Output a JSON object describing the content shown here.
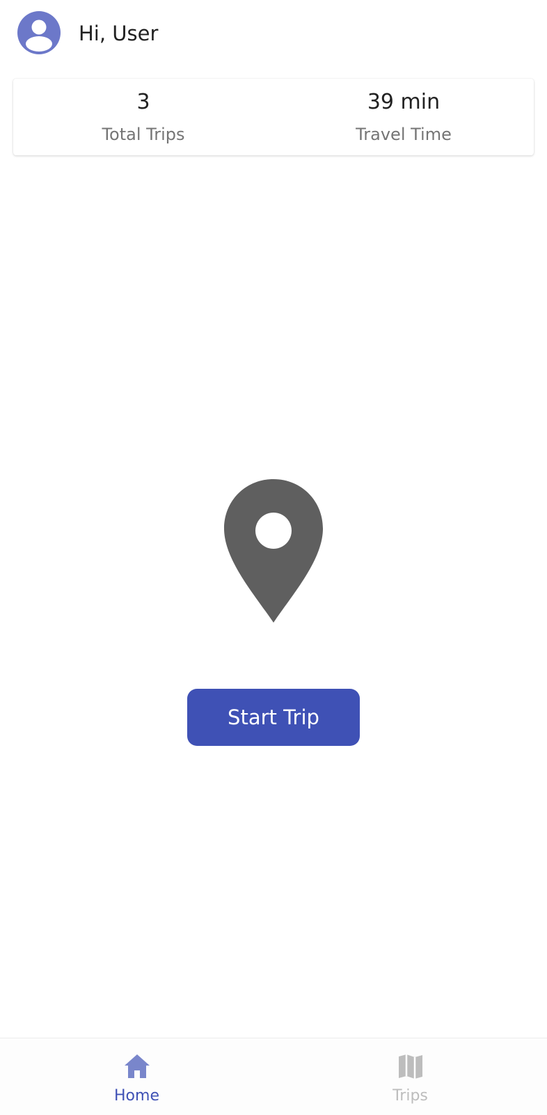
{
  "header": {
    "greeting": "Hi, User",
    "avatar_icon": "account-circle-icon"
  },
  "stats": [
    {
      "value": "3",
      "label": "Total Trips"
    },
    {
      "value": "39 min",
      "label": "Travel Time"
    }
  ],
  "main": {
    "pin_icon": "location-pin-icon",
    "start_button_label": "Start Trip"
  },
  "bottom_nav": {
    "items": [
      {
        "label": "Home",
        "icon": "home-icon",
        "active": true
      },
      {
        "label": "Trips",
        "icon": "map-icon",
        "active": false
      }
    ]
  },
  "colors": {
    "primary": "#3f51b5",
    "avatar": "#6c78c9",
    "pin": "#5f5f5f",
    "nav_active_icon": "#7986cb",
    "nav_inactive": "#bdbdbd"
  }
}
